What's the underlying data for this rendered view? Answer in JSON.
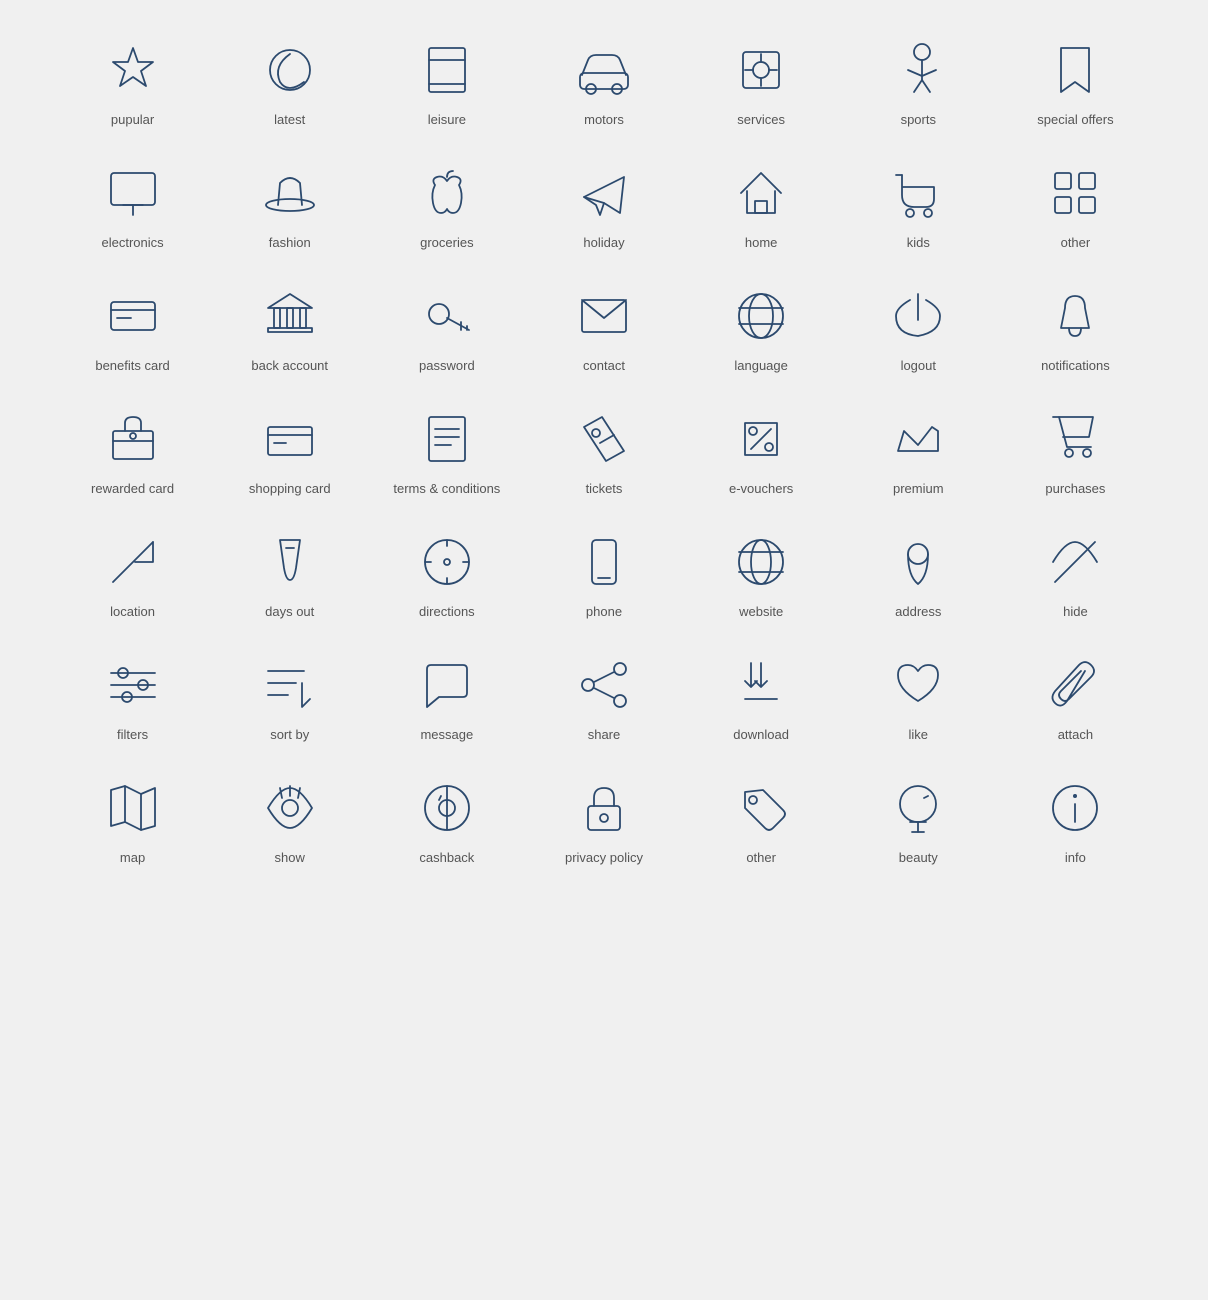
{
  "icons": [
    {
      "name": "popular-icon",
      "label": "pupular",
      "svg": "star"
    },
    {
      "name": "latest-icon",
      "label": "latest",
      "svg": "clock"
    },
    {
      "name": "leisure-icon",
      "label": "leisure",
      "svg": "book"
    },
    {
      "name": "motors-icon",
      "label": "motors",
      "svg": "car"
    },
    {
      "name": "services-icon",
      "label": "services",
      "svg": "services"
    },
    {
      "name": "sports-icon",
      "label": "sports",
      "svg": "sports"
    },
    {
      "name": "special-offers-icon",
      "label": "special offers",
      "svg": "bookmark"
    },
    {
      "name": "electronics-icon",
      "label": "electronics",
      "svg": "monitor"
    },
    {
      "name": "fashion-icon",
      "label": "fashion",
      "svg": "hat"
    },
    {
      "name": "groceries-icon",
      "label": "groceries",
      "svg": "apple"
    },
    {
      "name": "holiday-icon",
      "label": "holiday",
      "svg": "plane"
    },
    {
      "name": "home-icon",
      "label": "home",
      "svg": "house"
    },
    {
      "name": "kids-icon",
      "label": "kids",
      "svg": "stroller"
    },
    {
      "name": "other-icon-1",
      "label": "other",
      "svg": "grid"
    },
    {
      "name": "benefits-card-icon",
      "label": "benefits card",
      "svg": "card"
    },
    {
      "name": "back-account-icon",
      "label": "back account",
      "svg": "bank"
    },
    {
      "name": "password-icon",
      "label": "password",
      "svg": "key"
    },
    {
      "name": "contact-icon",
      "label": "contact",
      "svg": "envelope"
    },
    {
      "name": "language-icon",
      "label": "language",
      "svg": "globe"
    },
    {
      "name": "logout-icon",
      "label": "logout",
      "svg": "logout"
    },
    {
      "name": "notifications-icon",
      "label": "notifications",
      "svg": "bell"
    },
    {
      "name": "rewarded-card-icon",
      "label": "rewarded card",
      "svg": "rewarded"
    },
    {
      "name": "shopping-card-icon",
      "label": "shopping card",
      "svg": "shopcardalt"
    },
    {
      "name": "terms-icon",
      "label": "terms & conditions",
      "svg": "terms"
    },
    {
      "name": "tickets-icon",
      "label": "tickets",
      "svg": "ticket"
    },
    {
      "name": "evouchers-icon",
      "label": "e-vouchers",
      "svg": "voucher"
    },
    {
      "name": "premium-icon",
      "label": "premium",
      "svg": "crown"
    },
    {
      "name": "purchases-icon",
      "label": "purchases",
      "svg": "cart"
    },
    {
      "name": "location-icon",
      "label": "location",
      "svg": "send"
    },
    {
      "name": "days-out-icon",
      "label": "days out",
      "svg": "drink"
    },
    {
      "name": "directions-icon",
      "label": "directions",
      "svg": "compass"
    },
    {
      "name": "phone-icon",
      "label": "phone",
      "svg": "phone"
    },
    {
      "name": "website-icon",
      "label": "website",
      "svg": "website"
    },
    {
      "name": "address-icon",
      "label": "address",
      "svg": "pin"
    },
    {
      "name": "hide-icon",
      "label": "hide",
      "svg": "hide"
    },
    {
      "name": "filters-icon",
      "label": "filters",
      "svg": "filters"
    },
    {
      "name": "sort-by-icon",
      "label": "sort by",
      "svg": "sortby"
    },
    {
      "name": "message-icon",
      "label": "message",
      "svg": "message"
    },
    {
      "name": "share-icon",
      "label": "share",
      "svg": "share"
    },
    {
      "name": "download-icon",
      "label": "download",
      "svg": "download"
    },
    {
      "name": "like-icon",
      "label": "like",
      "svg": "heart"
    },
    {
      "name": "attach-icon",
      "label": "attach",
      "svg": "paperclip"
    },
    {
      "name": "map-icon",
      "label": "map",
      "svg": "map"
    },
    {
      "name": "show-icon",
      "label": "show",
      "svg": "show"
    },
    {
      "name": "cashback-icon",
      "label": "cashback",
      "svg": "cashback"
    },
    {
      "name": "privacy-icon",
      "label": "privacy policy",
      "svg": "lock"
    },
    {
      "name": "other-icon-2",
      "label": "other",
      "svg": "tag"
    },
    {
      "name": "beauty-icon",
      "label": "beauty",
      "svg": "mirror"
    },
    {
      "name": "info-icon",
      "label": "info",
      "svg": "info"
    }
  ]
}
